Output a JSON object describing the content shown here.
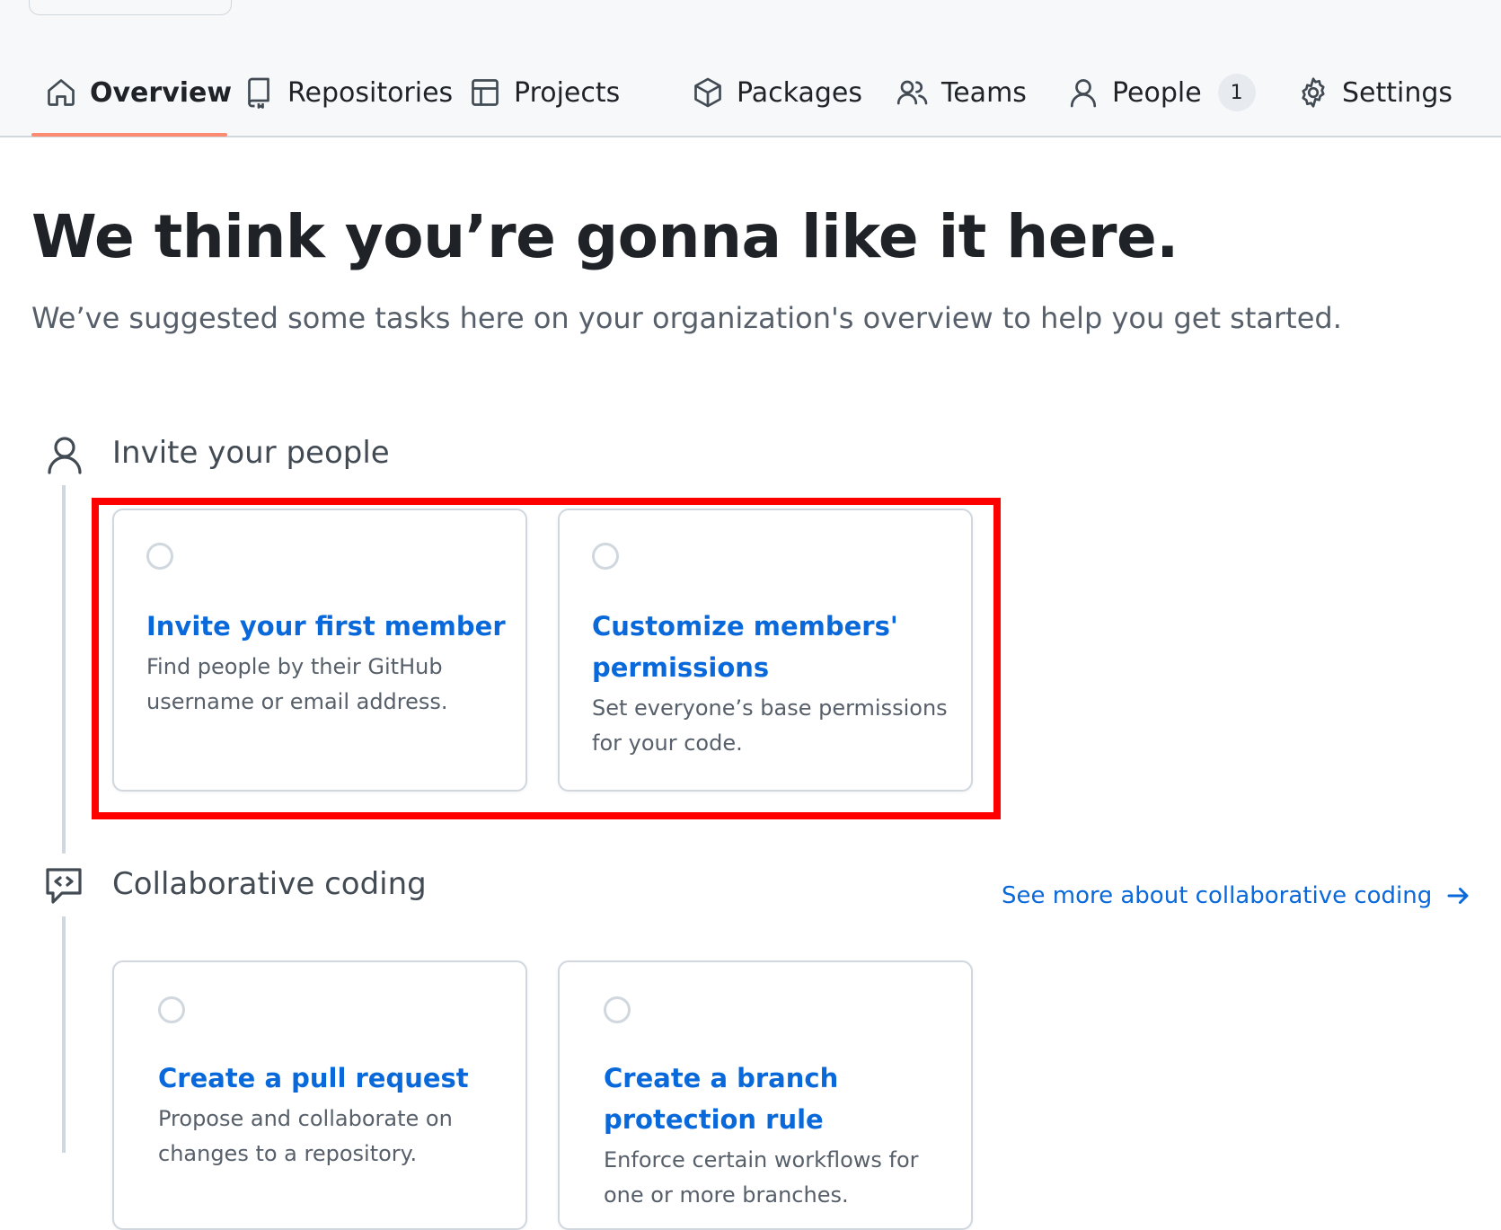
{
  "nav": {
    "tabs": [
      {
        "label": "Overview",
        "icon": "home-icon",
        "active": true
      },
      {
        "label": "Repositories",
        "icon": "repo-icon"
      },
      {
        "label": "Projects",
        "icon": "table-icon"
      },
      {
        "label": "Packages",
        "icon": "package-icon"
      },
      {
        "label": "Teams",
        "icon": "people-icon"
      },
      {
        "label": "People",
        "icon": "person-icon",
        "counter": "1"
      },
      {
        "label": "Settings",
        "icon": "gear-icon"
      }
    ],
    "active_color": "#fd8c73"
  },
  "main": {
    "headline": "We think you’re gonna like it here.",
    "subline": "We’ve suggested some tasks here on your organization's overview to help you get started."
  },
  "sections": [
    {
      "title": "Invite your people",
      "icon": "person-icon",
      "cards": [
        {
          "title": "Invite your first member",
          "description": "Find people by their GitHub username or email address."
        },
        {
          "title": "Customize members' permissions",
          "description": "Set everyone’s base permissions for your code."
        }
      ]
    },
    {
      "title": "Collaborative coding",
      "icon": "code-review-icon",
      "link": "See more about collaborative coding",
      "link_icon": "arrow-right-icon",
      "cards": [
        {
          "title": "Create a pull request",
          "description": "Propose and collaborate on changes to a repository."
        },
        {
          "title": "Create a branch protection rule",
          "description": "Enforce certain workflows for one or more branches."
        }
      ]
    }
  ],
  "colors": {
    "link": "#0969da",
    "highlight": "#ff0000",
    "muted": "#57606a"
  }
}
